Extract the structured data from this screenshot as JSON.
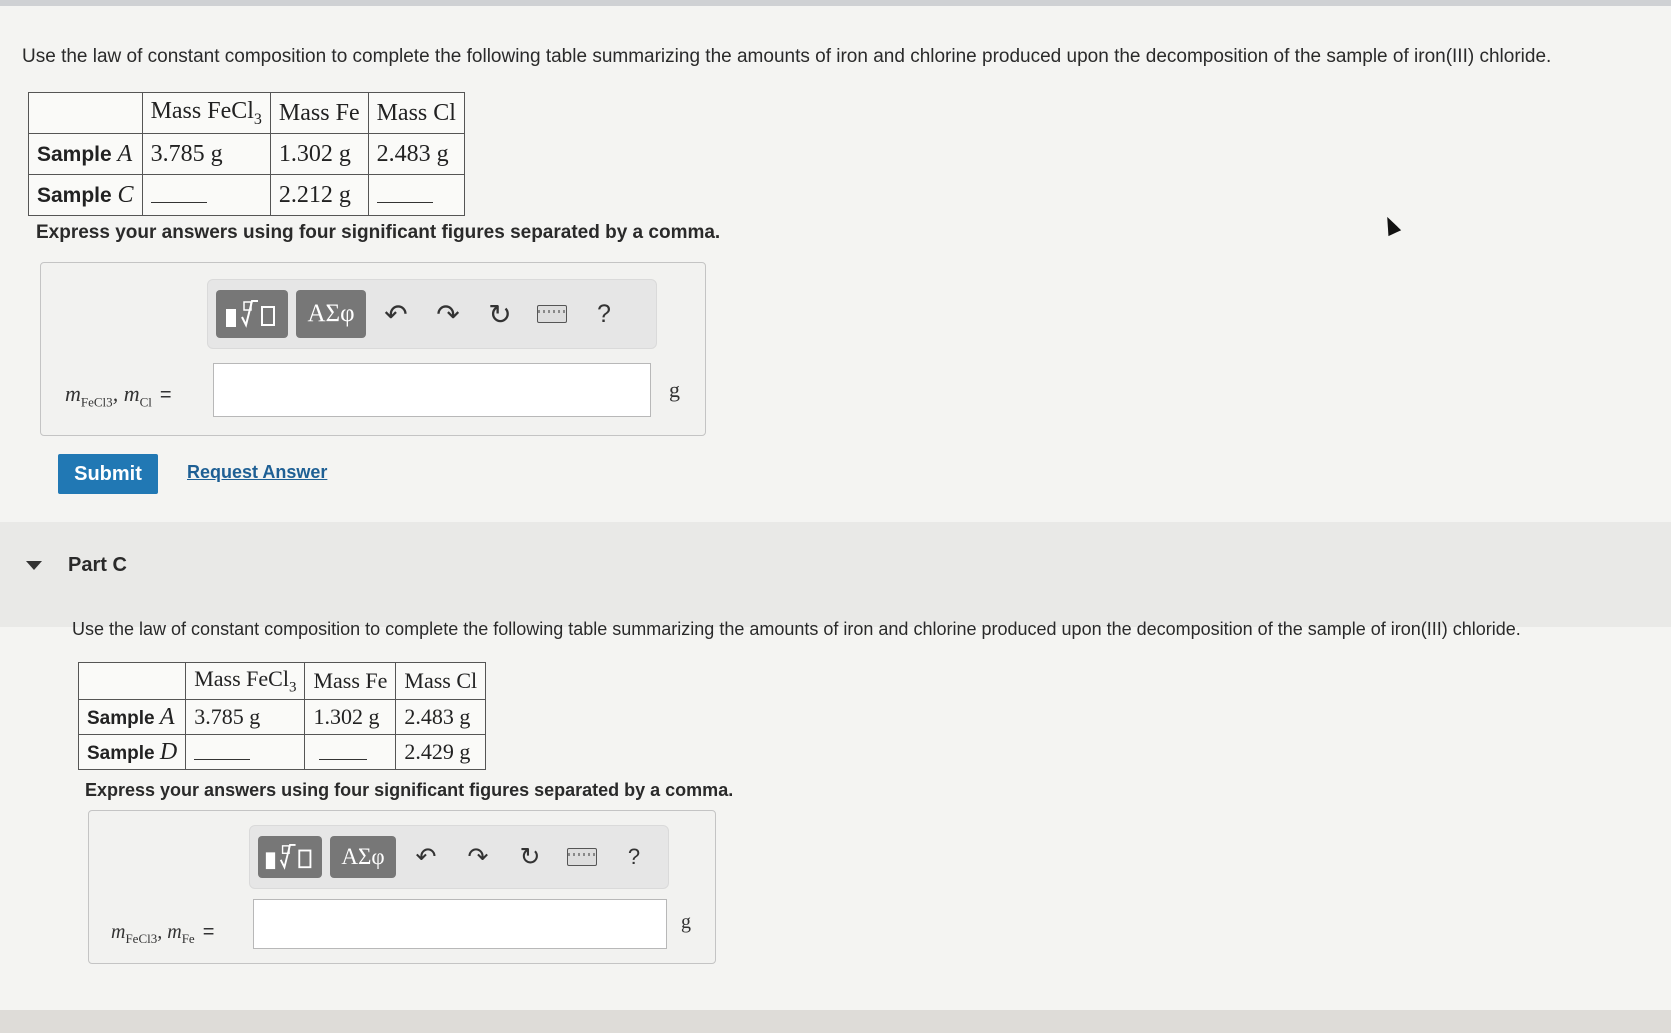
{
  "partB": {
    "intro": "Use the law of constant composition to complete the following table summarizing the amounts of iron and chlorine produced upon the decomposition of the sample of iron(III) chloride.",
    "table": {
      "headers": [
        "",
        "Mass FeCl3",
        "Mass Fe",
        "Mass Cl"
      ],
      "rows": [
        {
          "label": "Sample",
          "var": "A",
          "cells": [
            "3.785 g",
            "1.302 g",
            "2.483 g"
          ]
        },
        {
          "label": "Sample",
          "var": "C",
          "cells": [
            "",
            "2.212 g",
            ""
          ]
        }
      ]
    },
    "instruction": "Express your answers using four significant figures separated by a comma.",
    "answer_label_left": "m",
    "answer_sub_1": "FeCl3",
    "answer_sub_2": "Cl",
    "answer_value": "",
    "unit": "g",
    "submit_label": "Submit",
    "request_label": "Request Answer"
  },
  "toolbar": {
    "template_icon": "fraction-root-template-icon",
    "greek_label": "ΑΣφ",
    "undo_icon": "undo-icon",
    "redo_icon": "redo-icon",
    "reset_icon": "reset-icon",
    "keyboard_icon": "keyboard-icon",
    "help_label": "?"
  },
  "partC": {
    "title": "Part C",
    "intro": "Use the law of constant composition to complete the following table summarizing the amounts of iron and chlorine produced upon the decomposition of the sample of iron(III) chloride.",
    "table": {
      "headers": [
        "",
        "Mass FeCl3",
        "Mass Fe",
        "Mass Cl"
      ],
      "rows": [
        {
          "label": "Sample",
          "var": "A",
          "cells": [
            "3.785 g",
            "1.302 g",
            "2.483 g"
          ]
        },
        {
          "label": "Sample",
          "var": "D",
          "cells": [
            "",
            "",
            "2.429 g"
          ]
        }
      ]
    },
    "instruction": "Express your answers using four significant figures separated by a comma.",
    "answer_sub_1": "FeCl3",
    "answer_sub_2": "Fe",
    "answer_value": "",
    "unit": "g"
  }
}
